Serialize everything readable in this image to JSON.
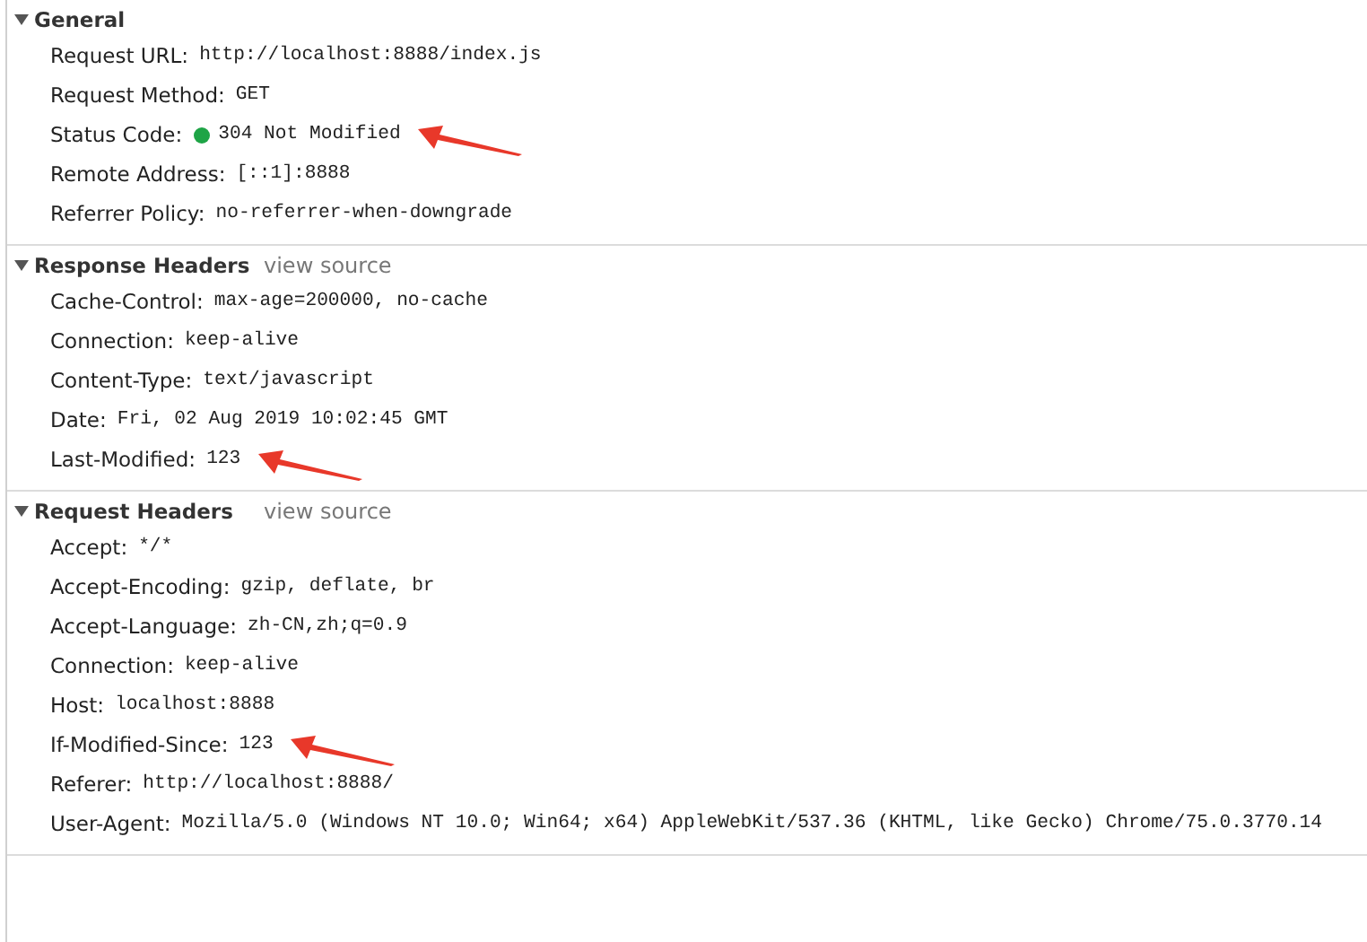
{
  "sections": [
    {
      "title": "General",
      "expanded": true,
      "rows": [
        {
          "name": "Request URL:",
          "value": "http://localhost:8888/index.js",
          "arrow": false
        },
        {
          "name": "Request Method:",
          "value": "GET",
          "arrow": false
        },
        {
          "name": "Status Code:",
          "value": "304 Not Modified",
          "color": "#1ea446",
          "arrow": true
        },
        {
          "name": "Remote Address:",
          "value": "[::1]:8888",
          "arrow": false
        },
        {
          "name": "Referrer Policy:",
          "value": "no-referrer-when-downgrade",
          "arrow": false
        }
      ]
    },
    {
      "title": "Response Headers",
      "link": "view source",
      "expanded": true,
      "rows": [
        {
          "name": "Cache-Control:",
          "value": "max-age=200000, no-cache",
          "arrow": false
        },
        {
          "name": "Connection:",
          "value": "keep-alive",
          "arrow": false
        },
        {
          "name": "Content-Type:",
          "value": "text/javascript",
          "arrow": false
        },
        {
          "name": "Date:",
          "value": "Fri, 02 Aug 2019 10:02:45 GMT",
          "arrow": false
        },
        {
          "name": "Last-Modified:",
          "value": "123",
          "arrow": true
        }
      ]
    },
    {
      "title": "Request Headers",
      "link": "view source",
      "expanded": true,
      "rows": [
        {
          "name": "Accept:",
          "value": "*/*",
          "arrow": false
        },
        {
          "name": "Accept-Encoding:",
          "value": "gzip, deflate, br",
          "arrow": false
        },
        {
          "name": "Accept-Language:",
          "value": "zh-CN,zh;q=0.9",
          "arrow": false
        },
        {
          "name": "Connection:",
          "value": "keep-alive",
          "arrow": false
        },
        {
          "name": "Host:",
          "value": "localhost:8888",
          "arrow": false
        },
        {
          "name": "If-Modified-Since:",
          "value": "123",
          "arrow": true
        },
        {
          "name": "Referer:",
          "value": "http://localhost:8888/",
          "arrow": false
        },
        {
          "name": "User-Agent:",
          "value": "Mozilla/5.0 (Windows NT 10.0; Win64; x64) AppleWebKit/537.36 (KHTML, like Gecko) Chrome/75.0.3770.14",
          "arrow": false
        }
      ]
    }
  ]
}
